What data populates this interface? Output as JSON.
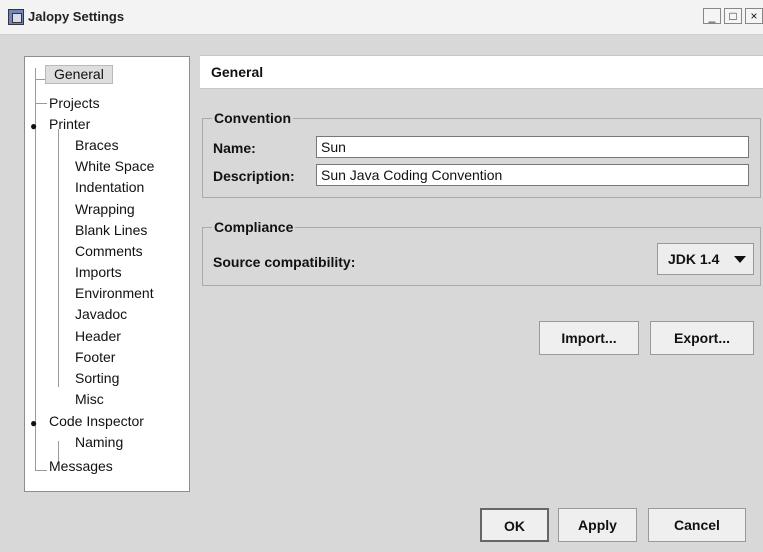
{
  "window": {
    "title": "Jalopy Settings",
    "controls": [
      "_",
      "□",
      "×"
    ]
  },
  "tree": {
    "items": [
      {
        "label": "General",
        "selected": true
      },
      {
        "label": "Projects"
      },
      {
        "label": "Printer"
      },
      {
        "label": "Braces"
      },
      {
        "label": "White Space"
      },
      {
        "label": "Indentation"
      },
      {
        "label": "Wrapping"
      },
      {
        "label": "Blank Lines"
      },
      {
        "label": "Comments"
      },
      {
        "label": "Imports"
      },
      {
        "label": "Environment"
      },
      {
        "label": "Javadoc"
      },
      {
        "label": "Header"
      },
      {
        "label": "Footer"
      },
      {
        "label": "Sorting"
      },
      {
        "label": "Misc"
      },
      {
        "label": "Code Inspector"
      },
      {
        "label": "Naming"
      },
      {
        "label": "Messages"
      }
    ]
  },
  "main": {
    "header": "General",
    "convention": {
      "legend": "Convention",
      "name_label": "Name:",
      "name_value": "Sun",
      "description_label": "Description:",
      "description_value": "Sun Java Coding Convention"
    },
    "compliance": {
      "legend": "Compliance",
      "source_label": "Source compatibility:",
      "source_value": "JDK 1.4"
    }
  },
  "buttons": {
    "import": "Import...",
    "export": "Export...",
    "ok": "OK",
    "apply": "Apply",
    "cancel": "Cancel"
  }
}
